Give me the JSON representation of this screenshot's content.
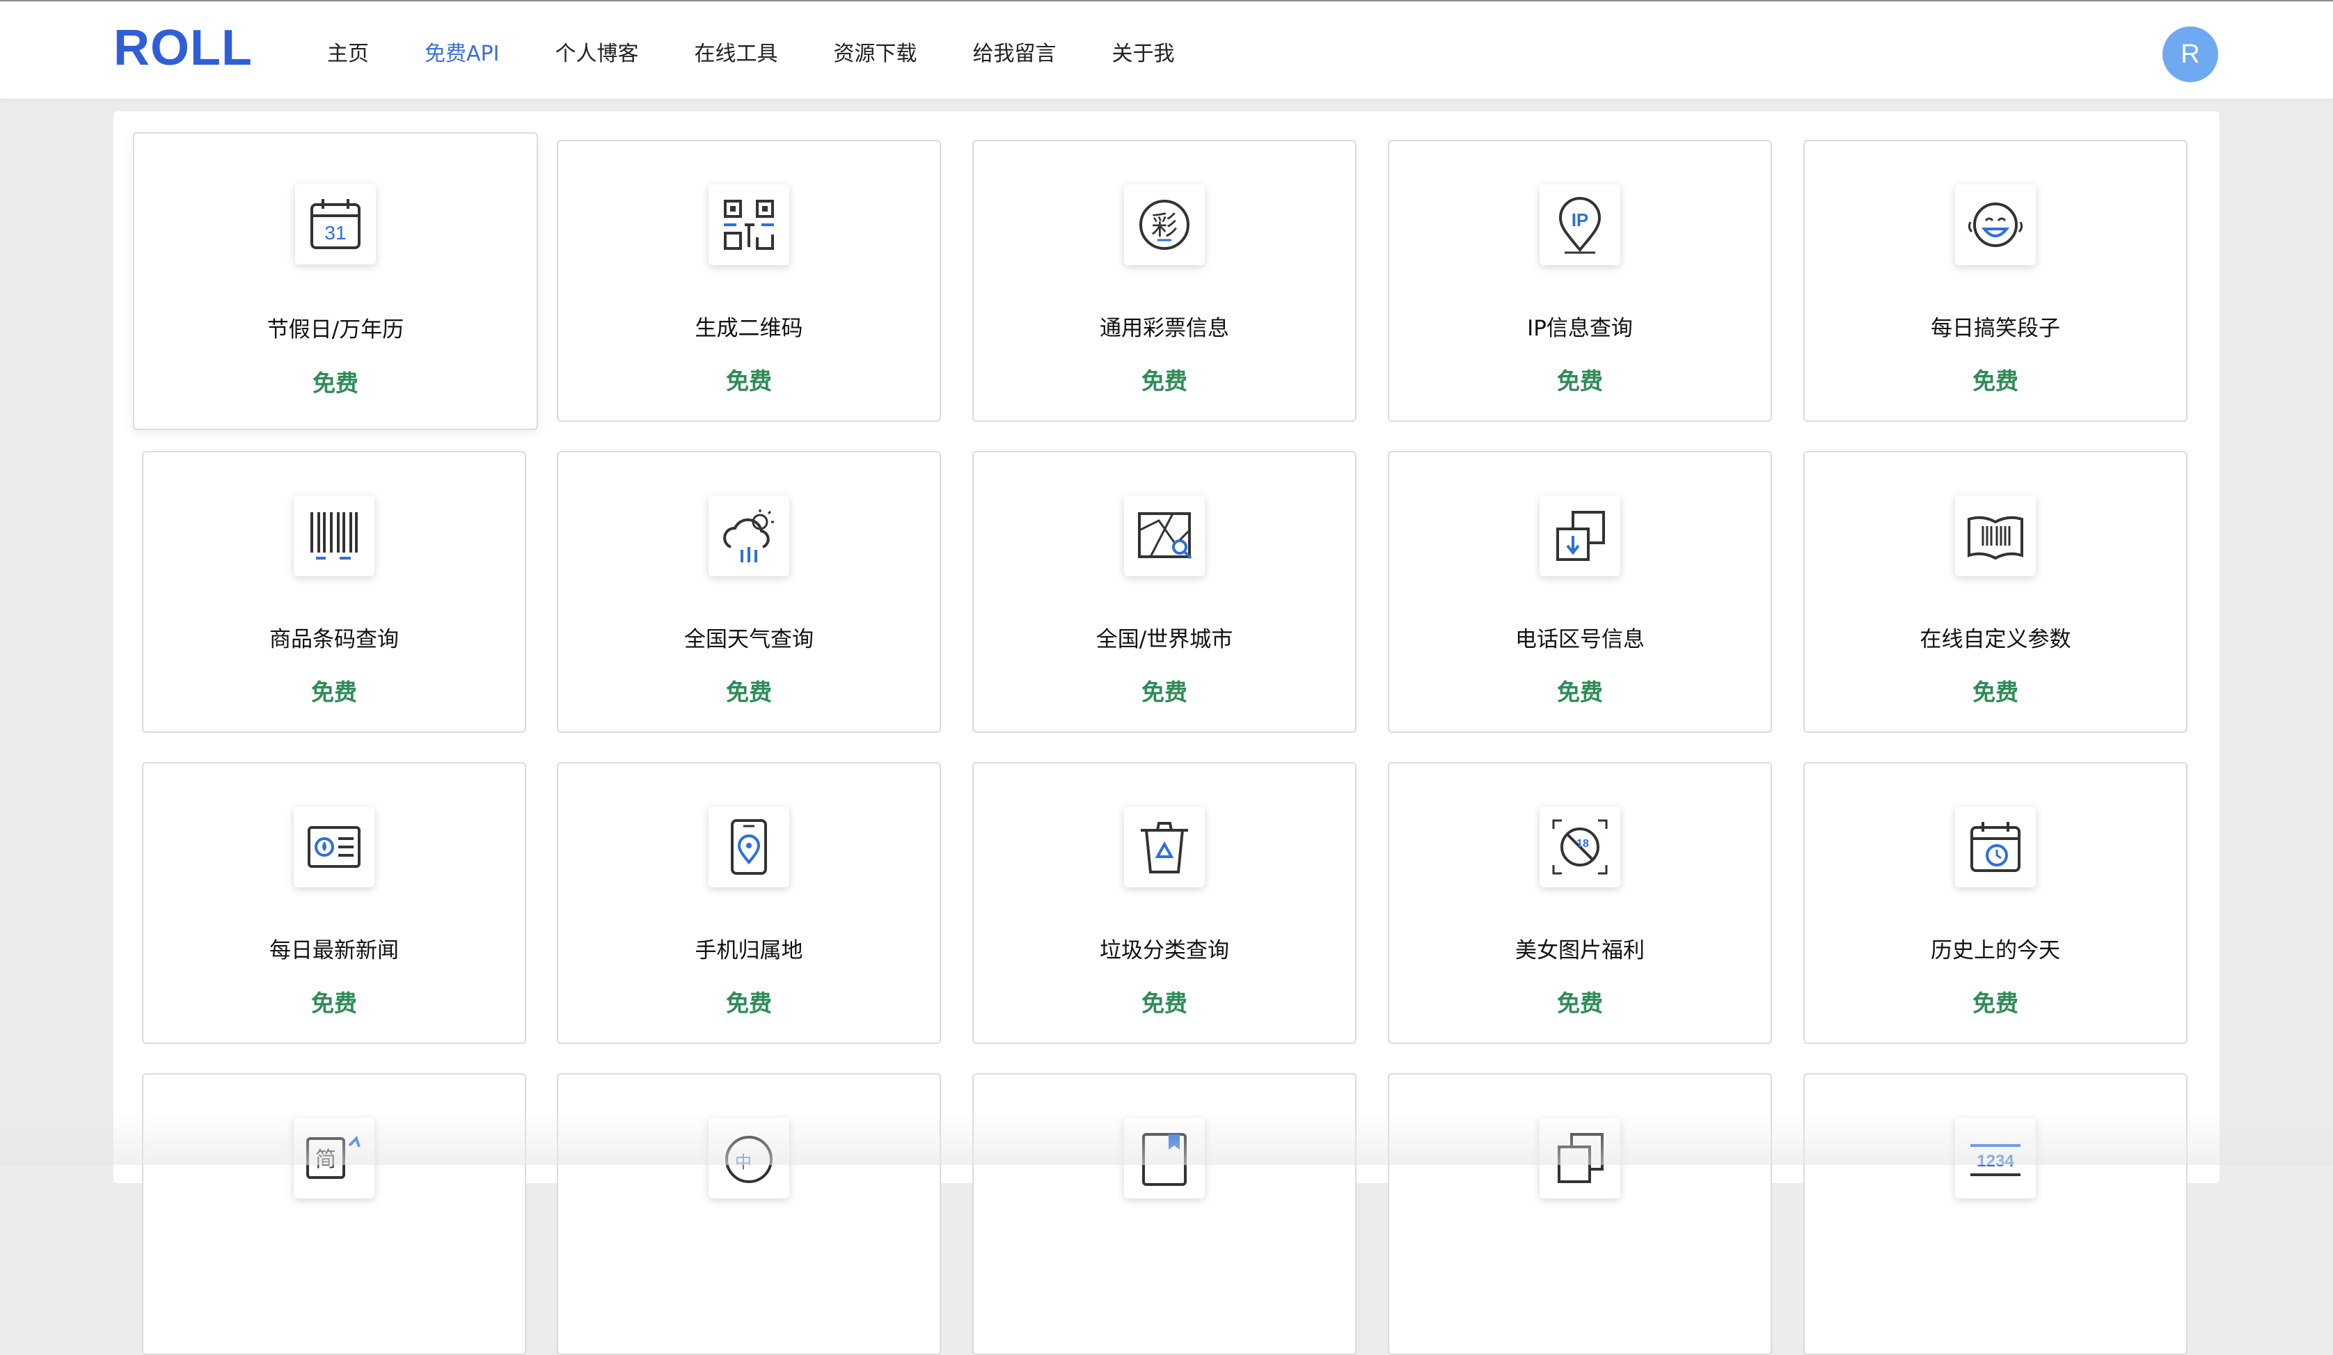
{
  "header": {
    "logo": "ROLL",
    "nav": [
      {
        "label": "主页",
        "name": "nav-home",
        "active": false
      },
      {
        "label": "免费API",
        "name": "nav-free-api",
        "active": true
      },
      {
        "label": "个人博客",
        "name": "nav-blog",
        "active": false
      },
      {
        "label": "在线工具",
        "name": "nav-tools",
        "active": false
      },
      {
        "label": "资源下载",
        "name": "nav-downloads",
        "active": false
      },
      {
        "label": "给我留言",
        "name": "nav-message",
        "active": false
      },
      {
        "label": "关于我",
        "name": "nav-about",
        "active": false
      }
    ],
    "avatar_letter": "R"
  },
  "colors": {
    "brand": "#2f5fd8",
    "accent": "#3a6fd8",
    "free": "#2e8b57",
    "icon_blue": "#2d6fe0",
    "icon_dark": "#333333"
  },
  "cards": [
    {
      "title": "节假日/万年历",
      "price": "免费",
      "icon": "calendar-icon",
      "hover": true
    },
    {
      "title": "生成二维码",
      "price": "免费",
      "icon": "qrcode-icon"
    },
    {
      "title": "通用彩票信息",
      "price": "免费",
      "icon": "lottery-icon"
    },
    {
      "title": "IP信息查询",
      "price": "免费",
      "icon": "ip-location-icon"
    },
    {
      "title": "每日搞笑段子",
      "price": "免费",
      "icon": "laugh-face-icon"
    },
    {
      "title": "商品条码查询",
      "price": "免费",
      "icon": "barcode-icon"
    },
    {
      "title": "全国天气查询",
      "price": "免费",
      "icon": "weather-icon"
    },
    {
      "title": "全国/世界城市",
      "price": "免费",
      "icon": "map-search-icon"
    },
    {
      "title": "电话区号信息",
      "price": "免费",
      "icon": "phone-area-code-icon"
    },
    {
      "title": "在线自定义参数",
      "price": "免费",
      "icon": "book-barcode-icon"
    },
    {
      "title": "每日最新新闻",
      "price": "免费",
      "icon": "news-icon"
    },
    {
      "title": "手机归属地",
      "price": "免费",
      "icon": "mobile-location-icon"
    },
    {
      "title": "垃圾分类查询",
      "price": "免费",
      "icon": "trash-recycle-icon"
    },
    {
      "title": "美女图片福利",
      "price": "免费",
      "icon": "age-restricted-icon"
    },
    {
      "title": "历史上的今天",
      "price": "免费",
      "icon": "history-calendar-icon"
    },
    {
      "title": "",
      "price": "",
      "icon": "simplified-traditional-icon"
    },
    {
      "title": "",
      "price": "",
      "icon": "chinese-translate-icon"
    },
    {
      "title": "",
      "price": "",
      "icon": "dictionary-icon"
    },
    {
      "title": "",
      "price": "",
      "icon": "copy-document-icon"
    },
    {
      "title": "",
      "price": "",
      "icon": "number-icon"
    }
  ]
}
